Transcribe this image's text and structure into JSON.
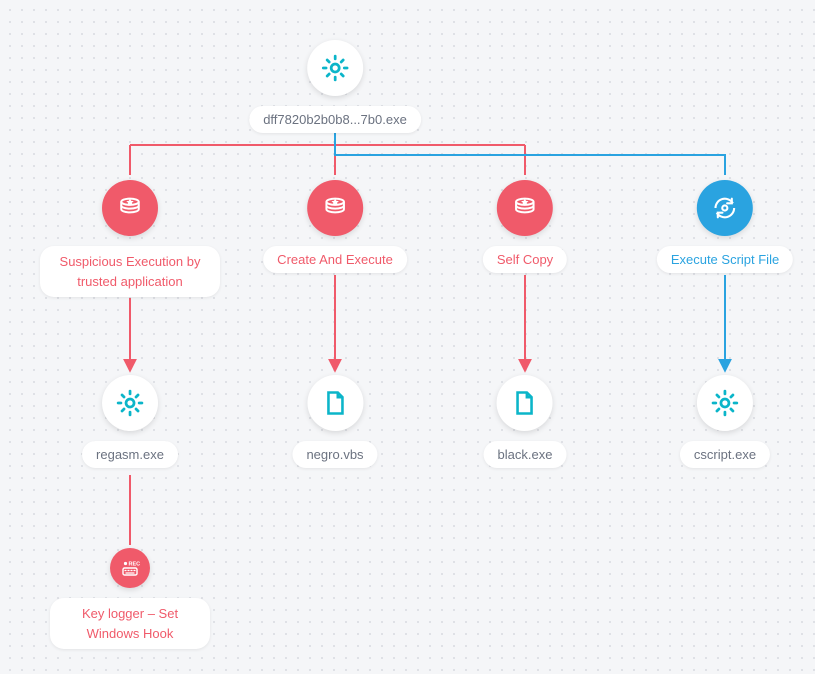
{
  "colors": {
    "red": "#f05a6a",
    "teal": "#0bb5c9",
    "blue": "#2aa3e0"
  },
  "root": {
    "label": "dff7820b2b0b8...7b0.exe"
  },
  "branches": [
    {
      "action": "Suspicious Execution by trusted application",
      "leafLabel": "regasm.exe",
      "leafIcon": "gear",
      "color": "red"
    },
    {
      "action": "Create And Execute",
      "leafLabel": "negro.vbs",
      "leafIcon": "file",
      "color": "red"
    },
    {
      "action": "Self Copy",
      "leafLabel": "black.exe",
      "leafIcon": "file",
      "color": "red"
    },
    {
      "action": "Execute Script File",
      "leafLabel": "cscript.exe",
      "leafIcon": "gear",
      "color": "blue"
    }
  ],
  "sub": {
    "action": "Key logger – Set Windows Hook",
    "icon": "rec"
  }
}
